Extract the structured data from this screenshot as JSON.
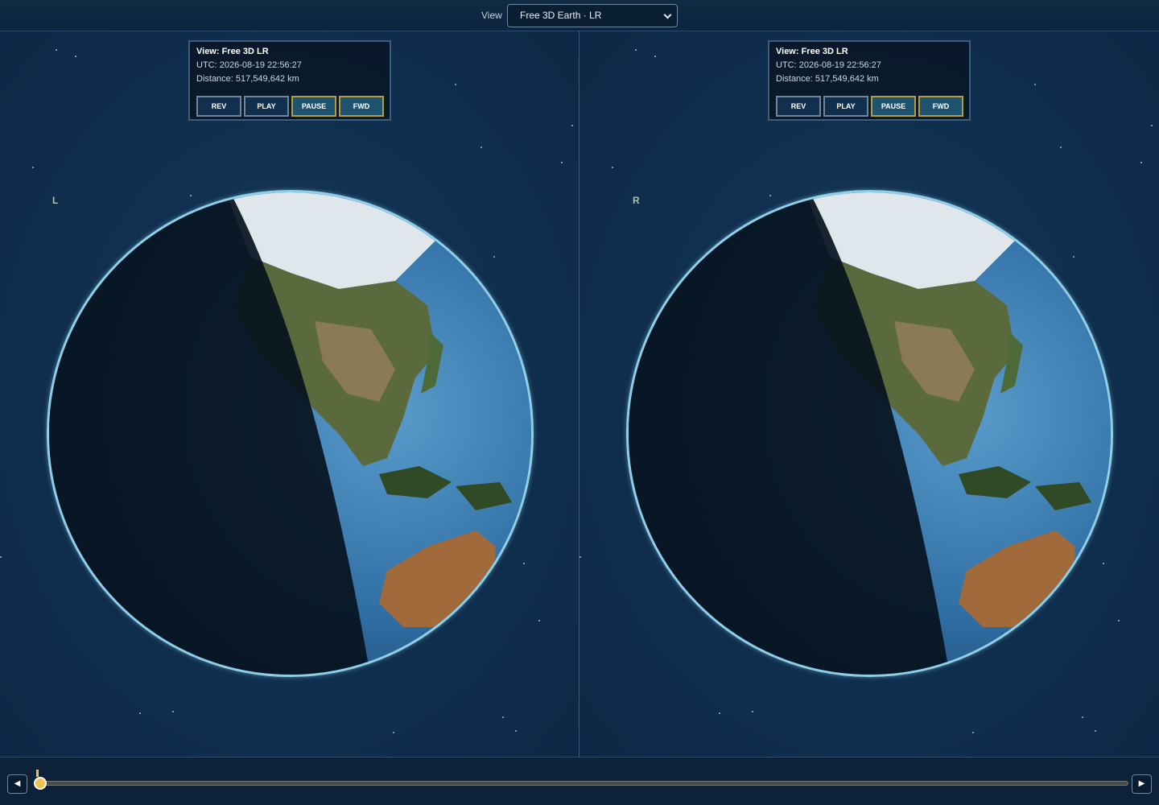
{
  "toolbar": {
    "view_label": "View",
    "view_selected": "Free 3D Earth · LR"
  },
  "panels": [
    {
      "eye_label": "L",
      "info": {
        "title": "View: Free 3D LR",
        "utc": "UTC: 2026-08-19 22:56:27",
        "distance": "Distance: 517,549,642 km"
      },
      "buttons": [
        {
          "label": "REV",
          "active": false
        },
        {
          "label": "PLAY",
          "active": false
        },
        {
          "label": "PAUSE",
          "active": true
        },
        {
          "label": "FWD",
          "active": true
        }
      ]
    },
    {
      "eye_label": "R",
      "info": {
        "title": "View: Free 3D LR",
        "utc": "UTC: 2026-08-19 22:56:27",
        "distance": "Distance: 517,549,642 km"
      },
      "buttons": [
        {
          "label": "REV",
          "active": false
        },
        {
          "label": "PLAY",
          "active": false
        },
        {
          "label": "PAUSE",
          "active": true
        },
        {
          "label": "FWD",
          "active": true
        }
      ]
    }
  ],
  "timeline": {
    "prev_icon": "◀",
    "next_icon": "▶",
    "position": 0.0
  },
  "colors": {
    "accent": "#f0c050",
    "globe_rim": "#8fcfe8",
    "active_button_border": "#b8983c"
  }
}
